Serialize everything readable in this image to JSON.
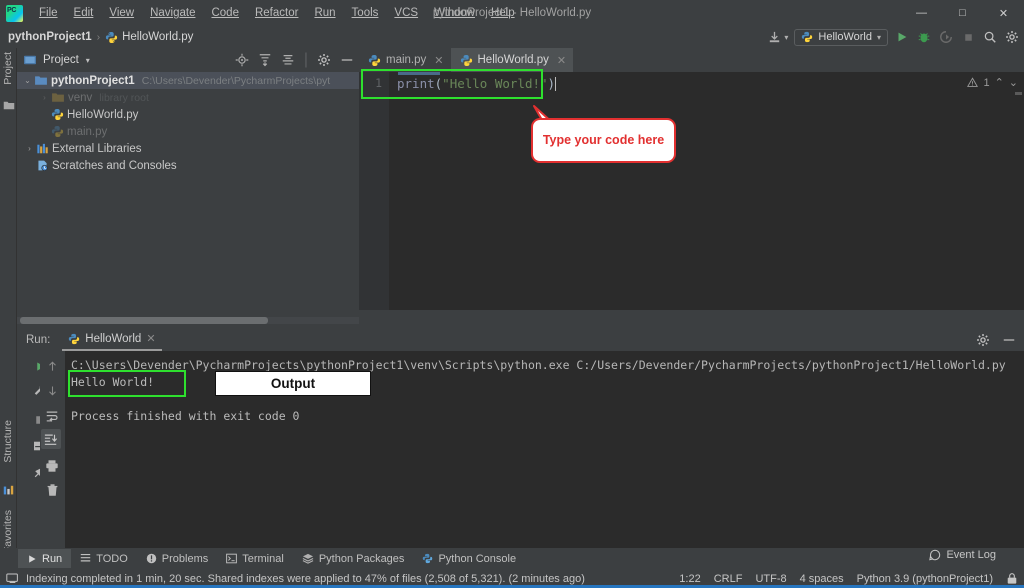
{
  "window": {
    "title": "pythonProject1 - HelloWorld.py",
    "logo_name": "pycharm-logo",
    "minimize": "—",
    "maximize": "□",
    "close": "✕"
  },
  "menu": {
    "items": [
      "File",
      "Edit",
      "View",
      "Navigate",
      "Code",
      "Refactor",
      "Run",
      "Tools",
      "VCS",
      "Window",
      "Help"
    ]
  },
  "navbar": {
    "project": "pythonProject1",
    "separator": "›",
    "file": "HelloWorld.py",
    "run_config": "HelloWorld",
    "dropdown_caret": "▾"
  },
  "left_rail": {
    "top_label": "Project",
    "structure_label": "Structure",
    "favorites_label": "Favorites"
  },
  "project_panel": {
    "title": "Project",
    "caret": "▾",
    "tree": [
      {
        "label": "pythonProject1",
        "path": "C:\\Users\\Devender\\PycharmProjects\\pyt",
        "arrow": "⌄",
        "icon": "folder-icon",
        "indent": 0,
        "bold": true,
        "selected": true,
        "faded": false
      },
      {
        "label": "venv",
        "path": "library root",
        "arrow": "›",
        "icon": "folder-icon",
        "indent": 1,
        "bold": false,
        "selected": false,
        "faded": true
      },
      {
        "label": "HelloWorld.py",
        "path": "",
        "arrow": "",
        "icon": "python-file-icon",
        "indent": 1,
        "bold": false,
        "selected": false,
        "faded": false
      },
      {
        "label": "main.py",
        "path": "",
        "arrow": "",
        "icon": "python-file-icon",
        "indent": 1,
        "bold": false,
        "selected": false,
        "faded": true
      },
      {
        "label": "External Libraries",
        "path": "",
        "arrow": "›",
        "icon": "library-icon",
        "indent": 0,
        "bold": false,
        "selected": false,
        "faded": false
      },
      {
        "label": "Scratches and Consoles",
        "path": "",
        "arrow": "",
        "icon": "scratches-icon",
        "indent": 0,
        "bold": false,
        "selected": false,
        "faded": false
      }
    ]
  },
  "editor": {
    "tabs": [
      {
        "label": "main.py",
        "active": false,
        "close": "✕"
      },
      {
        "label": "HelloWorld.py",
        "active": true,
        "close": "✕"
      }
    ],
    "line_number": "1",
    "code": {
      "fn": "print",
      "open_paren": "(",
      "string": "\"Hello World!\"",
      "close_paren": ")"
    },
    "warning_count": "1",
    "warning_icon": "warning-triangle-icon",
    "chevron_up": "⌃",
    "chevron_down": "⌄"
  },
  "annotations": {
    "code_callout": "Type your code here",
    "output_label": "Output"
  },
  "run_panel": {
    "label": "Run:",
    "tab": "HelloWorld",
    "tab_close": "✕",
    "console_lines": [
      "C:\\Users\\Devender\\PycharmProjects\\pythonProject1\\venv\\Scripts\\python.exe C:/Users/Devender/PycharmProjects/pythonProject1/HelloWorld.py",
      "Hello World!",
      "",
      "Process finished with exit code 0"
    ]
  },
  "bottom_toolbar": {
    "buttons": [
      {
        "label": "Run",
        "icon": "run-play-icon",
        "active": true
      },
      {
        "label": "TODO",
        "icon": "todo-list-icon",
        "active": false
      },
      {
        "label": "Problems",
        "icon": "problems-icon",
        "active": false
      },
      {
        "label": "Terminal",
        "icon": "terminal-icon",
        "active": false
      },
      {
        "label": "Python Packages",
        "icon": "packages-icon",
        "active": false
      },
      {
        "label": "Python Console",
        "icon": "python-console-icon",
        "active": false
      }
    ]
  },
  "status_bar": {
    "message": "Indexing completed in 1 min, 20 sec. Shared indexes were applied to 47% of files (2,508 of 5,321). (2 minutes ago)",
    "event_log": "Event Log",
    "caret_position": "1:22",
    "line_separator": "CRLF",
    "encoding": "UTF-8",
    "indent": "4 spaces",
    "interpreter": "Python 3.9 (pythonProject1)"
  },
  "colors": {
    "accent_blue": "#2675bf",
    "highlight_green": "#2ee02e",
    "callout_red": "#e23030",
    "bg_dark": "#3c3f41",
    "editor_bg": "#2b2b2b"
  }
}
